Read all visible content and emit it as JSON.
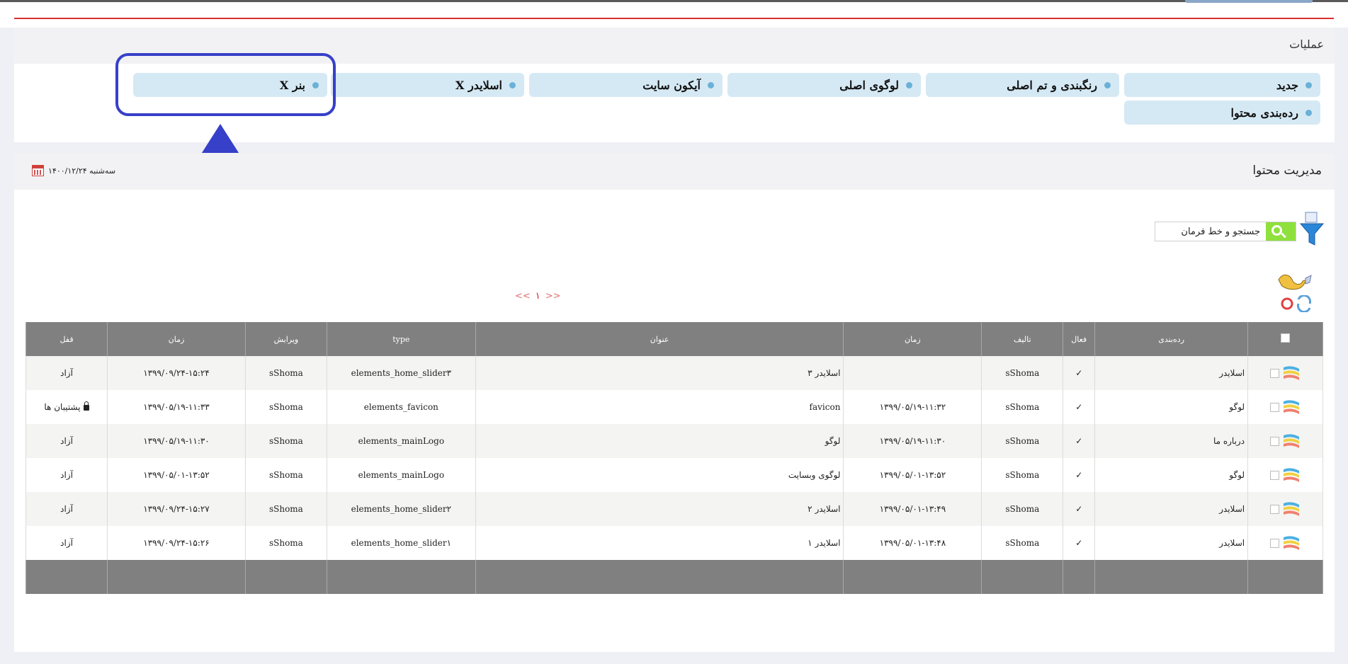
{
  "operations": {
    "title": "عملیات",
    "buttons": [
      {
        "label": "جدید"
      },
      {
        "label": "رنگبندی و تم اصلی"
      },
      {
        "label": "لوگوی اصلی"
      },
      {
        "label": "آیکون سایت"
      },
      {
        "label": "اسلایدر X"
      },
      {
        "label": "بنر X"
      },
      {
        "label": "ردەبندی محتوا"
      }
    ]
  },
  "content": {
    "title": "مدیریت محتوا",
    "date": "سەشنبە ۱۴۰۰/۱۲/۲۴",
    "search_label": "جستجو و خط فرمان",
    "pager": {
      "prev": "<<",
      "current": "۱",
      "next": ">>"
    },
    "columns": [
      "",
      "رده‌بندی",
      "فعال",
      "تالیف",
      "زمان",
      "عنوان",
      "type",
      "ویرایش",
      "زمان",
      "قفل"
    ],
    "rows": [
      {
        "category": "اسلایدر",
        "active": "✓",
        "author": "sShoma",
        "time1": "",
        "title": "اسلایدر ۳",
        "type": "elements_home_slider۳",
        "editor": "sShoma",
        "time2": "۱۳۹۹/۰۹/۲۴-۱۵:۲۴",
        "lock": "آزاد"
      },
      {
        "category": "لوگو",
        "active": "✓",
        "author": "sShoma",
        "time1": "۱۳۹۹/۰۵/۱۹-۱۱:۳۲",
        "title": "favicon",
        "type": "elements_favicon",
        "editor": "sShoma",
        "time2": "۱۳۹۹/۰۵/۱۹-۱۱:۳۳",
        "lock": "پشتیبان ها"
      },
      {
        "category": "درباره ما",
        "active": "✓",
        "author": "sShoma",
        "time1": "۱۳۹۹/۰۵/۱۹-۱۱:۳۰",
        "title": "لوگو",
        "type": "elements_mainLogo",
        "editor": "sShoma",
        "time2": "۱۳۹۹/۰۵/۱۹-۱۱:۳۰",
        "lock": "آزاد"
      },
      {
        "category": "لوگو",
        "active": "✓",
        "author": "sShoma",
        "time1": "۱۳۹۹/۰۵/۰۱-۱۳:۵۲",
        "title": "لوگوی وبسایت",
        "type": "elements_mainLogo",
        "editor": "sShoma",
        "time2": "۱۳۹۹/۰۵/۰۱-۱۳:۵۲",
        "lock": "آزاد"
      },
      {
        "category": "اسلایدر",
        "active": "✓",
        "author": "sShoma",
        "time1": "۱۳۹۹/۰۵/۰۱-۱۳:۴۹",
        "title": "اسلایدر ۲",
        "type": "elements_home_slider۲",
        "editor": "sShoma",
        "time2": "۱۳۹۹/۰۹/۲۴-۱۵:۲۷",
        "lock": "آزاد"
      },
      {
        "category": "اسلایدر",
        "active": "✓",
        "author": "sShoma",
        "time1": "۱۳۹۹/۰۵/۰۱-۱۳:۴۸",
        "title": "اسلایدر ۱",
        "type": "elements_home_slider۱",
        "editor": "sShoma",
        "time2": "۱۳۹۹/۰۹/۲۴-۱۵:۲۶",
        "lock": "آزاد"
      }
    ]
  },
  "colors": {
    "accent_red": "#d9302c",
    "highlight": "#3740c8",
    "button_bg": "#d5e9f4",
    "header_gray": "#808080",
    "search_green": "#8ee03c"
  }
}
